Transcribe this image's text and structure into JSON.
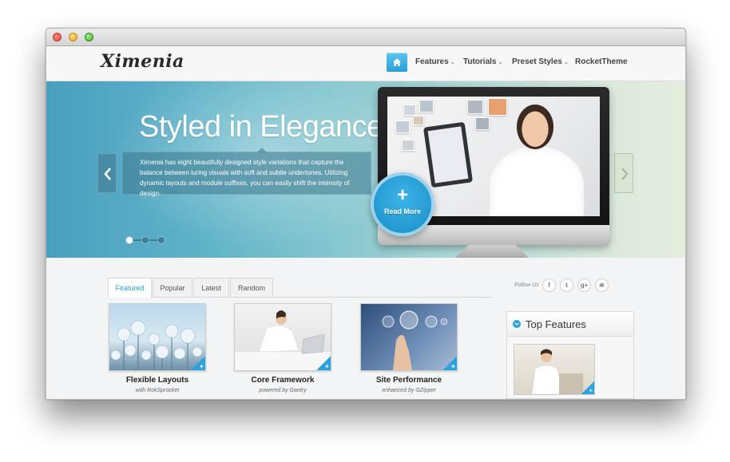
{
  "window": {
    "traffic_lights": [
      "close",
      "minimize",
      "zoom"
    ]
  },
  "header": {
    "logo": "Ximenia",
    "home_icon": "home-icon",
    "nav": [
      {
        "label": "Features",
        "has_dropdown": true
      },
      {
        "label": "Tutorials",
        "has_dropdown": true
      },
      {
        "label": "Preset Styles",
        "has_dropdown": true
      },
      {
        "label": "RocketTheme",
        "has_dropdown": false
      }
    ],
    "caret": "⌄"
  },
  "hero": {
    "title": "Styled in Elegance",
    "description": "Ximenia has eight beautifully designed style variations that capture the balance between luring visuals with soft and subtle undertones. Utilizing dynamic layouts and module suffixes, you can easily shift the intensity of design.",
    "read_more": {
      "plus": "+",
      "label": "Read More"
    },
    "slides_total": 3,
    "active_slide": 1
  },
  "tabs": {
    "items": [
      "Featured",
      "Popular",
      "Latest",
      "Random"
    ],
    "active": "Featured"
  },
  "follow": {
    "label": "Follow Us",
    "icons": [
      {
        "name": "facebook-icon",
        "glyph": "f"
      },
      {
        "name": "twitter-icon",
        "glyph": "t"
      },
      {
        "name": "google-plus-icon",
        "glyph": "g+"
      },
      {
        "name": "rss-icon",
        "glyph": "≋"
      }
    ]
  },
  "features": [
    {
      "title": "Flexible Layouts",
      "subtitle": "with RokSprocket"
    },
    {
      "title": "Core Framework",
      "subtitle": "powered by Gantry"
    },
    {
      "title": "Site Performance",
      "subtitle": "enhanced by GZipper"
    }
  ],
  "thumb_corner": "+",
  "sidebar": {
    "title": "Top Features"
  },
  "colors": {
    "accent": "#2a9fd6",
    "hero_left": "#4a9fbf",
    "hero_right": "#e6eedd"
  }
}
